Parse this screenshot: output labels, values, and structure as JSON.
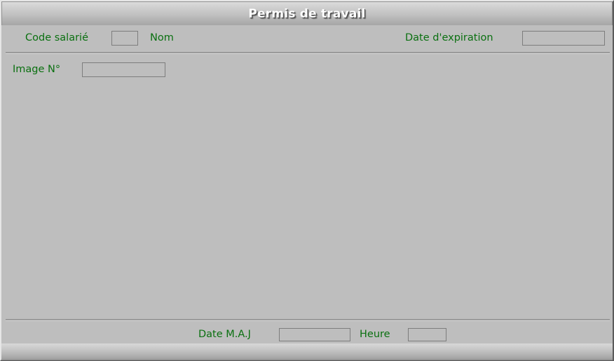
{
  "window": {
    "title": "Permis de travail"
  },
  "header": {
    "code_salarie_label": "Code salarié",
    "code_salarie_value": "",
    "code_salarie_placeholder": "",
    "nom_label": "Nom",
    "nom_value": "",
    "date_expiration_label": "Date d'expiration",
    "date_expiration_value": "",
    "date_expiration_placeholder": ""
  },
  "body": {
    "image_num_label": "Image N°",
    "image_num_value": "",
    "image_num_placeholder": ""
  },
  "footer": {
    "date_maj_label": "Date M.A.J",
    "date_maj_value": "",
    "date_maj_placeholder": "",
    "heure_label": "Heure",
    "heure_value": "",
    "heure_placeholder": ""
  },
  "colors": {
    "label_green": "#0a7010",
    "panel_gray": "#bebebe",
    "field_border": "#7d7d7d",
    "title_text": "#ffffff"
  }
}
